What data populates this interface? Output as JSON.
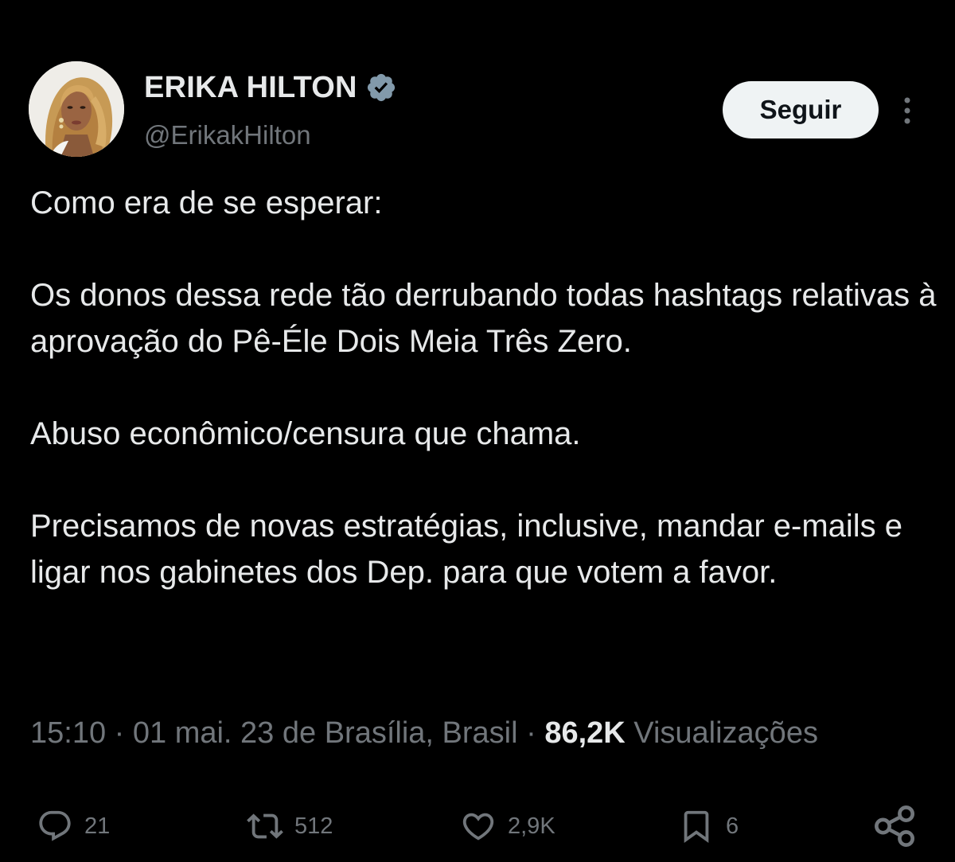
{
  "author": {
    "display_name": "ERIKA HILTON",
    "handle": "@ErikakHilton",
    "verified_icon": "verified-badge-icon",
    "avatar": "avatar-photo"
  },
  "follow_button_label": "Seguir",
  "more_icon": "more-vertical-icon",
  "tweet": {
    "paragraphs": [
      "Como era de se esperar:",
      "Os donos dessa rede tão derrubando todas hashtags relativas à aprovação do Pê-Éle Dois Meia Três Zero.",
      "Abuso econômico/censura que chama.",
      "Precisamos de novas estratégias, inclusive, mandar e-mails e ligar nos gabinetes dos Dep. para que votem a favor."
    ]
  },
  "meta": {
    "time": "15:10",
    "separator": "·",
    "date_location": "01 mai. 23 de Brasília, Brasil",
    "views_count": "86,2K",
    "views_label": "Visualizações"
  },
  "actions": {
    "reply": {
      "icon": "reply-icon",
      "count": "21"
    },
    "retweet": {
      "icon": "retweet-icon",
      "count": "512"
    },
    "like": {
      "icon": "heart-icon",
      "count": "2,9K"
    },
    "bookmark": {
      "icon": "bookmark-icon",
      "count": "6"
    },
    "share": {
      "icon": "share-icon"
    }
  },
  "colors": {
    "background": "#000000",
    "primary_text": "#e7e9ea",
    "secondary_text": "#71767b",
    "verified_badge": "#829aab",
    "follow_button_bg": "#eff3f4"
  }
}
